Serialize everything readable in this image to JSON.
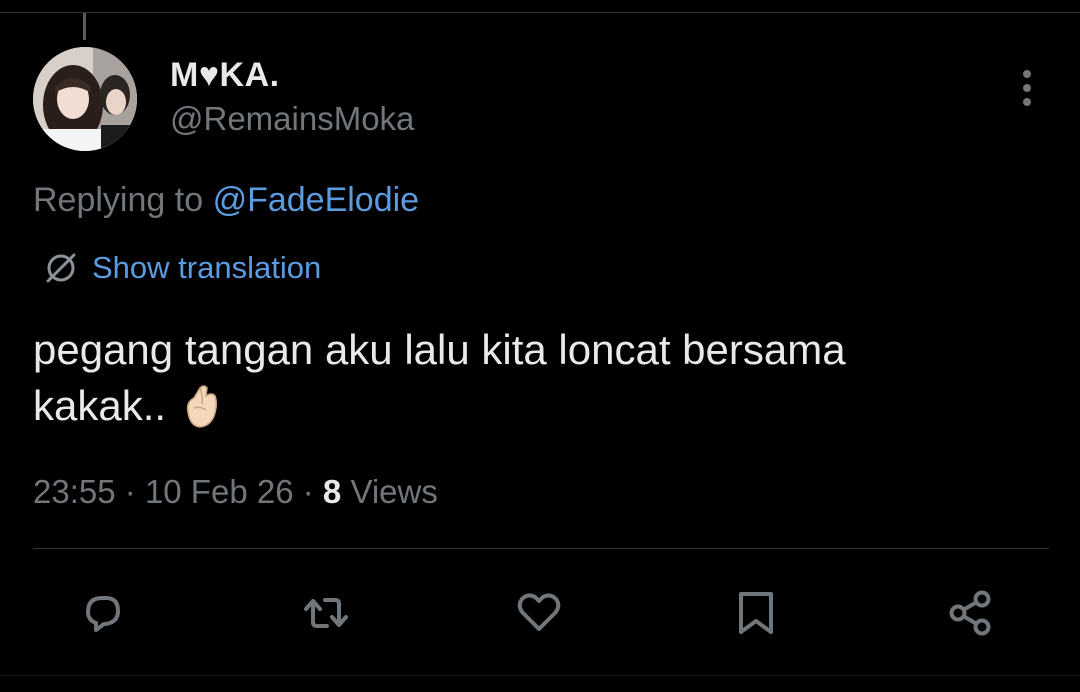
{
  "tweet": {
    "author": {
      "display_name": "M♥KA.",
      "handle": "@RemainsMoka",
      "avatar_icon": "profile-photo"
    },
    "reply": {
      "prefix": "Replying to",
      "mention": "@FadeElodie"
    },
    "translation_label": "Show translation",
    "text_line1": "pegang tangan aku lalu kita loncat bersama",
    "text_line2": "kakak..",
    "emoji": "finger-heart-emoji",
    "meta": {
      "time": "23:55",
      "date": "10 Feb 26",
      "views_count": "8",
      "views_label": "Views"
    },
    "actions": [
      "reply-icon",
      "retweet-icon",
      "like-icon",
      "bookmark-icon",
      "share-icon"
    ]
  },
  "colors": {
    "background": "#000000",
    "text_primary": "#e7e9ea",
    "text_secondary": "#71767b",
    "link": "#5b9be0",
    "divider": "#2f3336"
  }
}
